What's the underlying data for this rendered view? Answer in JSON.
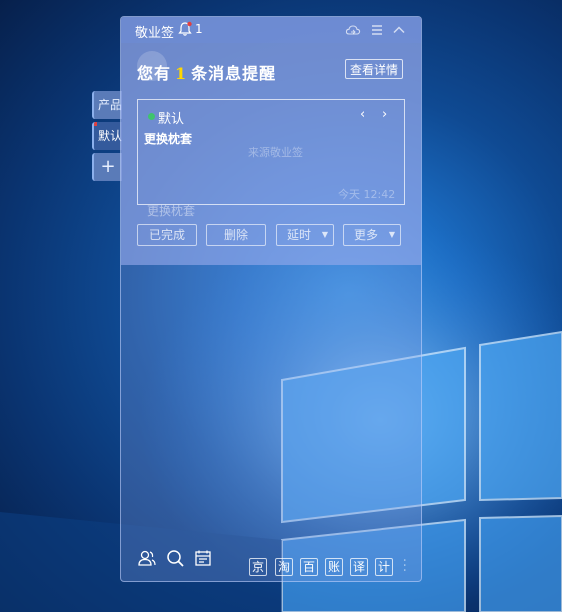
{
  "app": {
    "title": "敬业签",
    "notification_count": "1"
  },
  "side_tabs": [
    {
      "label": "产品"
    },
    {
      "label": "默认"
    },
    {
      "label": "+"
    }
  ],
  "alert": {
    "prefix": "您有",
    "count": "1",
    "suffix": "条消息提醒",
    "detail_button": "查看详情"
  },
  "message": {
    "category": "默认",
    "prev_icon": "chevron-left-icon",
    "next_icon": "chevron-right-icon",
    "content": "更换枕套",
    "ghost_source": "来源敬业签",
    "ghost_time": "今天 12:42",
    "ghost_title": "更换枕套"
  },
  "actions": [
    {
      "label": "已完成",
      "has_menu": false
    },
    {
      "label": "删除",
      "has_menu": false
    },
    {
      "label": "延时",
      "has_menu": true
    },
    {
      "label": "更多",
      "has_menu": true
    }
  ],
  "toolbar": {
    "icons": [
      "contacts-icon",
      "search-icon",
      "calendar-icon"
    ],
    "quick_links": [
      "京",
      "淘",
      "百",
      "账",
      "译",
      "计"
    ]
  },
  "colors": {
    "accent_dot": "#3ec46d",
    "count_highlight": "#ffd700",
    "badge": "#e04040"
  }
}
